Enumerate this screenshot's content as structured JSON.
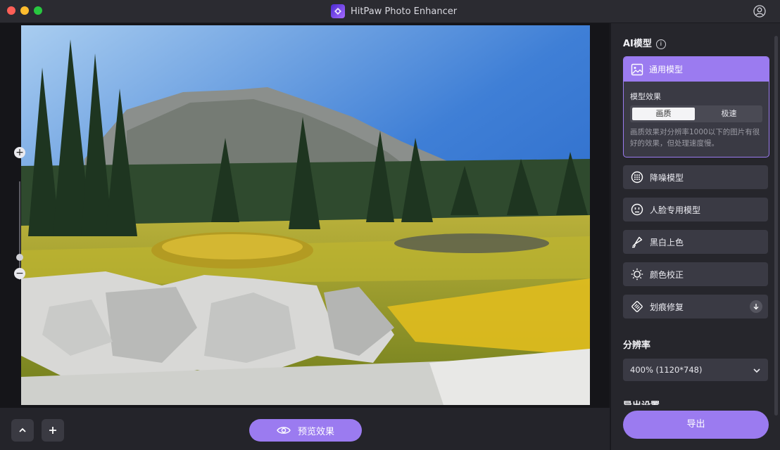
{
  "window": {
    "title": "HitPaw Photo Enhancer"
  },
  "icons": {
    "app_logo": "hitpaw-logo-icon",
    "account": "user-account-icon",
    "zoom_in": "plus-icon",
    "zoom_out": "minus-icon",
    "collapse": "chevron-up-icon",
    "add": "plus-icon",
    "preview": "eye-icon",
    "info": "info-icon",
    "download": "download-icon",
    "dropdown": "chevron-down-icon"
  },
  "colors": {
    "accent": "#9b7bf0",
    "panel": "#26262c",
    "card": "#3a3a44"
  },
  "canvas": {
    "zoom_in": "+",
    "zoom_out": "−",
    "zoom_level": 0.1
  },
  "bottom_bar": {
    "preview_label": "预览效果"
  },
  "panel": {
    "ai_model_title": "AI模型",
    "info_glyph": "i",
    "active_model": {
      "name": "通用模型",
      "effect_label": "模型效果",
      "options": [
        "画质",
        "极速"
      ],
      "selected_option": "画质",
      "description": "画质效果对分辨率1000以下的图片有很好的效果，但处理速度慢。"
    },
    "models": [
      {
        "name": "降噪模型",
        "icon": "noise-reduction-icon"
      },
      {
        "name": "人脸专用模型",
        "icon": "face-icon"
      },
      {
        "name": "黑白上色",
        "icon": "colorize-brush-icon"
      },
      {
        "name": "颜色校正",
        "icon": "brightness-sun-icon"
      },
      {
        "name": "划痕修复",
        "icon": "scratch-repair-icon"
      }
    ],
    "resolution_title": "分辨率",
    "resolution_value": "400% (1120*748)",
    "export_settings_title": "导出设置",
    "export_label": "导出"
  }
}
